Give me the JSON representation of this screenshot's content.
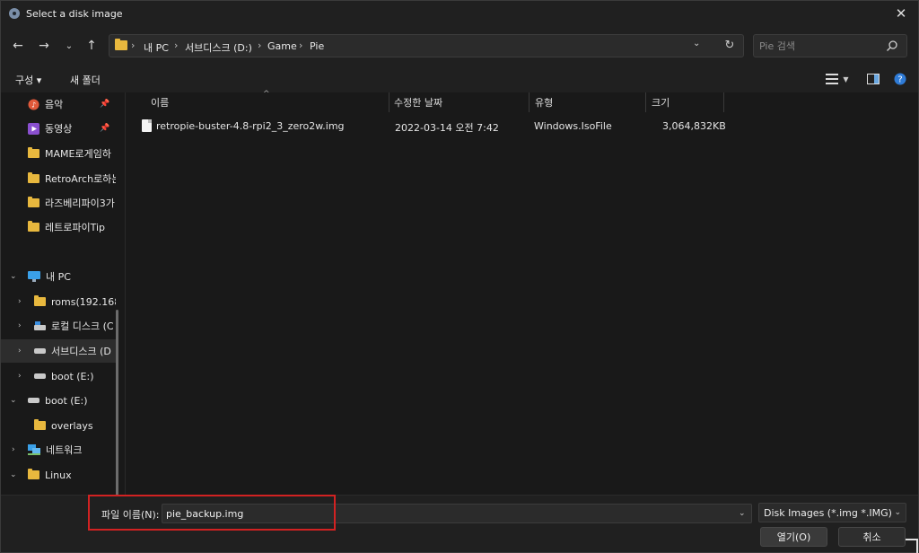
{
  "window": {
    "title": "Select a disk image"
  },
  "address": {
    "crumbs": [
      "내 PC",
      "서브디스크 (D:)",
      "Game",
      "Pie"
    ]
  },
  "search": {
    "placeholder": "Pie 검색"
  },
  "toolbar": {
    "organize": "구성 ▾",
    "new_folder": "새 폴더"
  },
  "nav": {
    "quick": [
      {
        "label": "음악",
        "icon": "music-icon",
        "pinned": true
      },
      {
        "label": "동영상",
        "icon": "video-icon",
        "pinned": true
      },
      {
        "label": "MAME로게임하",
        "icon": "folder-icon"
      },
      {
        "label": "RetroArch로하는",
        "icon": "folder-icon"
      },
      {
        "label": "라즈베리파이3가",
        "icon": "folder-icon"
      },
      {
        "label": "레트로파이Tip",
        "icon": "folder-icon"
      }
    ],
    "tree": [
      {
        "label": "내 PC",
        "icon": "pc-icon",
        "expanded": true
      },
      {
        "label": "roms(192.168",
        "icon": "folder-icon"
      },
      {
        "label": "로컬 디스크 (C",
        "icon": "drive-icon"
      },
      {
        "label": "서브디스크 (D",
        "icon": "drive-icon",
        "selected": true
      },
      {
        "label": "boot (E:)",
        "icon": "drive-icon"
      },
      {
        "label": "boot (E:)",
        "icon": "drive-icon",
        "expanded": true
      },
      {
        "label": "overlays",
        "icon": "folder-icon"
      },
      {
        "label": "네트워크",
        "icon": "network-icon"
      },
      {
        "label": "Linux",
        "icon": "folder-icon",
        "expanded": true
      }
    ]
  },
  "columns": {
    "name": "이름",
    "modified": "수정한 날짜",
    "type": "유형",
    "size": "크기"
  },
  "files": [
    {
      "name": "retropie-buster-4.8-rpi2_3_zero2w.img",
      "modified": "2022-03-14 오전 7:42",
      "type": "Windows.IsoFile",
      "size": "3,064,832KB"
    }
  ],
  "bottom": {
    "filename_label": "파일 이름(N):",
    "filename_value": "pie_backup.img",
    "filter": "Disk Images (*.img *.IMG)",
    "open_label": "열기(O)",
    "cancel_label": "취소"
  }
}
